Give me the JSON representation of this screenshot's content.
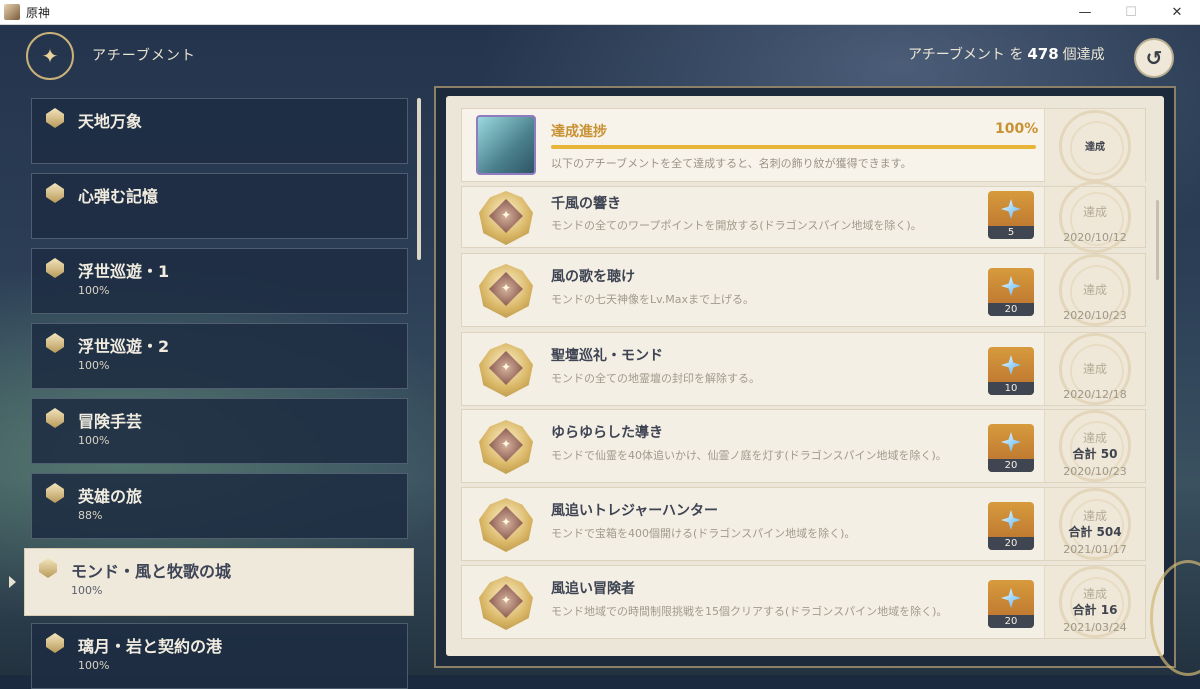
{
  "window": {
    "title": "原神",
    "minimize": "—",
    "maximize": "☐",
    "close": "✕"
  },
  "header": {
    "title": "アチーブメント",
    "count_prefix": "アチーブメント を",
    "count": "478",
    "count_suffix": "個達成",
    "back_icon": "↺"
  },
  "categories": [
    {
      "name": "天地万象",
      "percent": ""
    },
    {
      "name": "心弾む記憶",
      "percent": ""
    },
    {
      "name": "浮世巡遊・1",
      "percent": "100%"
    },
    {
      "name": "浮世巡遊・2",
      "percent": "100%"
    },
    {
      "name": "冒険手芸",
      "percent": "100%"
    },
    {
      "name": "英雄の旅",
      "percent": "88%"
    },
    {
      "name": "モンド・風と牧歌の城",
      "percent": "100%"
    },
    {
      "name": "璃月・岩と契約の港",
      "percent": "100%"
    }
  ],
  "progress": {
    "title": "達成進捗",
    "percent_label": "100%",
    "value": 1.0,
    "description": "以下のアチーブメントを全て達成すると、名刺の飾り紋が獲得できます。",
    "stamp": "達成"
  },
  "achievements": [
    {
      "title": "千風の響き",
      "description": "モンドの全てのワープポイントを開放する(ドラゴンスパイン地域を除く)。",
      "reward": "5",
      "status": "達成",
      "total": "",
      "date": "2020/10/12"
    },
    {
      "title": "風の歌を聴け",
      "description": "モンドの七天神像をLv.Maxまで上げる。",
      "reward": "20",
      "status": "達成",
      "total": "",
      "date": "2020/10/23"
    },
    {
      "title": "聖壇巡礼・モンド",
      "description": "モンドの全ての地霊壇の封印を解除する。",
      "reward": "10",
      "status": "達成",
      "total": "",
      "date": "2020/12/18"
    },
    {
      "title": "ゆらゆらした導き",
      "description": "モンドで仙霊を40体追いかけ、仙霊ノ庭を灯す(ドラゴンスパイン地域を除く)。",
      "reward": "20",
      "status": "達成",
      "total": "合計 50",
      "date": "2020/10/23"
    },
    {
      "title": "風追いトレジャーハンター",
      "description": "モンドで宝箱を400個開ける(ドラゴンスパイン地域を除く)。",
      "reward": "20",
      "status": "達成",
      "total": "合計 504",
      "date": "2021/01/17"
    },
    {
      "title": "風追い冒険者",
      "description": "モンド地域での時間制限挑戦を15個クリアする(ドラゴンスパイン地域を除く)。",
      "reward": "20",
      "status": "達成",
      "total": "合計 16",
      "date": "2021/03/24"
    }
  ]
}
